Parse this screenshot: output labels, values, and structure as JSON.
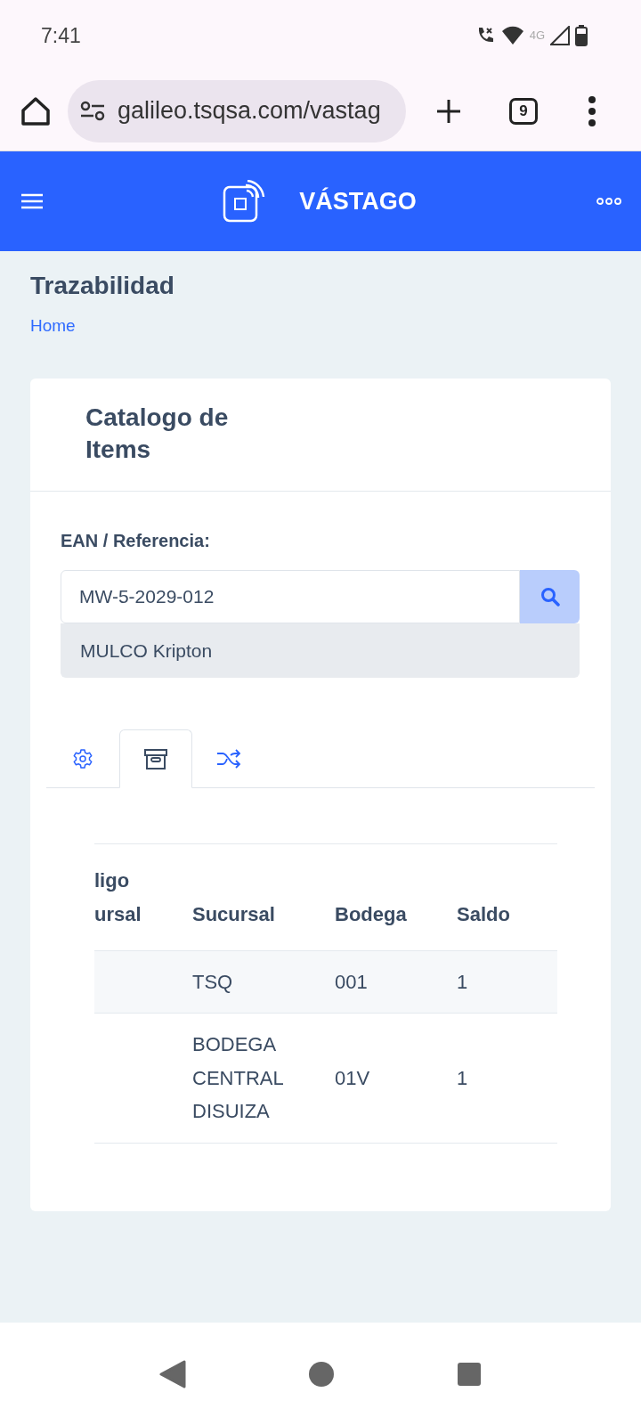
{
  "status_bar": {
    "time": "7:41",
    "network": "4G"
  },
  "browser": {
    "url": "galileo.tsqsa.com/vastag",
    "tab_count": "9"
  },
  "navbar": {
    "brand": "VÁSTAGO"
  },
  "page": {
    "title": "Trazabilidad",
    "breadcrumb": "Home"
  },
  "card": {
    "title": "Catalogo de Items",
    "search": {
      "label": "EAN / Referencia:",
      "value": "MW-5-2029-012",
      "suggestion": "MULCO Kripton"
    },
    "tabs": [
      {
        "kind": "gear",
        "selected": false
      },
      {
        "kind": "box",
        "selected": true
      },
      {
        "kind": "shuffle",
        "selected": false
      }
    ],
    "table": {
      "columns": [
        "ligo ursal",
        "Sucursal",
        "Bodega",
        "Saldo"
      ],
      "rows": [
        {
          "cells": [
            "",
            "TSQ",
            "001",
            "1"
          ]
        },
        {
          "cells": [
            "",
            "BODEGA CENTRAL DISUIZA",
            "01V",
            "1"
          ]
        }
      ]
    }
  }
}
